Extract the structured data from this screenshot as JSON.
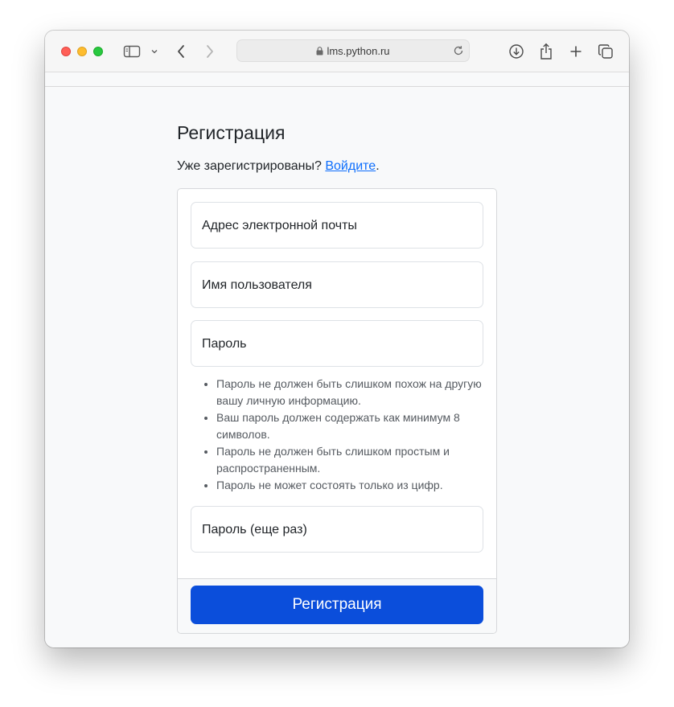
{
  "browser": {
    "url": "lms.python.ru",
    "icons": [
      "sidebar-icon",
      "chevron-down-icon",
      "back-icon",
      "forward-icon",
      "lock-icon",
      "reload-icon",
      "download-icon",
      "share-icon",
      "new-tab-icon",
      "tabs-overview-icon"
    ]
  },
  "page": {
    "title": "Регистрация",
    "login_prompt": "Уже зарегистрированы?",
    "login_link": "Войдите",
    "login_suffix": "."
  },
  "form": {
    "email_label": "Адрес электронной почты",
    "username_label": "Имя пользователя",
    "password_label": "Пароль",
    "password_hints": [
      "Пароль не должен быть слишком похож на другую вашу личную информацию.",
      "Ваш пароль должен содержать как минимум 8 символов.",
      "Пароль не должен быть слишком простым и распространенным.",
      "Пароль не может состоять только из цифр."
    ],
    "password_confirm_label": "Пароль (еще раз)",
    "submit_label": "Регистрация"
  },
  "colors": {
    "accent": "#0b4edb",
    "link": "#0d6efd"
  }
}
